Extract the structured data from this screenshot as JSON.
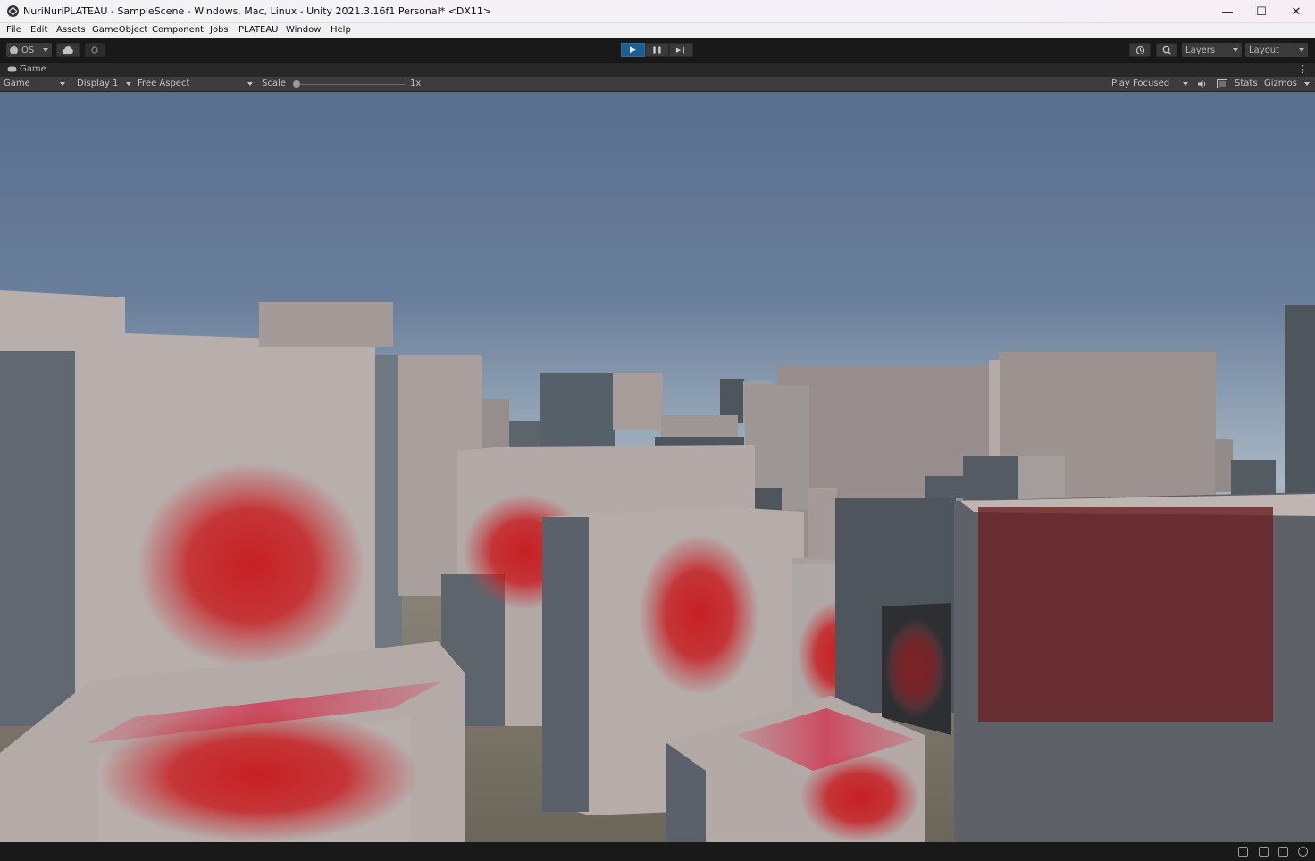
{
  "window": {
    "title": "NuriNuriPLATEAU - SampleScene - Windows, Mac, Linux - Unity 2021.3.16f1 Personal* <DX11>",
    "controls": {
      "minimize": "—",
      "maximize": "☐",
      "close": "✕"
    }
  },
  "menu": {
    "items": [
      "File",
      "Edit",
      "Assets",
      "GameObject",
      "Component",
      "Jobs",
      "PLATEAU",
      "Window",
      "Help"
    ]
  },
  "toolbar": {
    "account_label": "OS",
    "play_icons": {
      "play": "▶",
      "pause": "❚❚",
      "step": "▶❙"
    },
    "layers_label": "Layers",
    "layout_label": "Layout"
  },
  "tab": {
    "label": "Game",
    "menu_icon": "⋮"
  },
  "gameview": {
    "mode": "Game",
    "display": "Display 1",
    "aspect": "Free Aspect",
    "scale_label": "Scale",
    "scale_value": 0.0,
    "scale_text": "1x",
    "play_mode": "Play Focused",
    "stats_label": "Stats",
    "gizmos_label": "Gizmos"
  },
  "colors": {
    "sky_top": "#5a6e8e",
    "sky_horizon": "#a9b8c4",
    "building_light": "#b8afac",
    "building_mid": "#968d8c",
    "building_dark": "#4f555d",
    "heat_red": "#c8181c",
    "play_active": "#1f5d8f"
  }
}
